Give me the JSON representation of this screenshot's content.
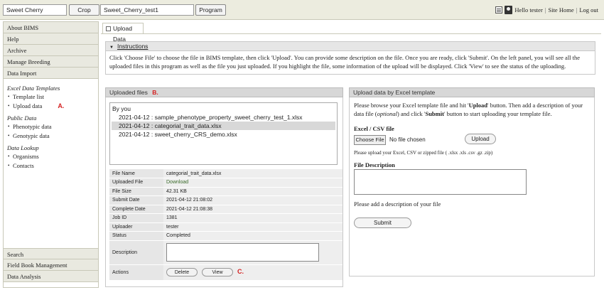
{
  "topbar": {
    "organism_value": "Sweet Cherry",
    "crop_button": "Crop",
    "program_value": "Sweet_Cherry_test1",
    "program_button": "Program",
    "greeting": "Hello tester",
    "sep": "|",
    "site_home": "Site Home",
    "logout": "Log out"
  },
  "sidebar": {
    "about": "About BIMS",
    "help": "Help",
    "archive": "Archive",
    "manage_breeding": "Manage Breeding",
    "data_import": "Data Import",
    "excel_section": "Excel Data Templates",
    "template_list": "Template list",
    "upload_data": "Upload data",
    "marker_a": "A.",
    "public_section": "Public Data",
    "phenotypic": "Phenotypic data",
    "genotypic": "Genotypic data",
    "lookup_section": "Data Lookup",
    "organisms": "Organisms",
    "contacts": "Contacts",
    "search": "Search",
    "field_book": "Field Book Management",
    "data_analysis": "Data Analysis"
  },
  "tab": {
    "label": "Upload Data"
  },
  "instructions": {
    "title": "Instructions",
    "line1": "Click 'Choose File' to choose the file in BIMS template, then click 'Upload'. You can provide some description on the file. Once you are ready, click 'Submit'. On the left panel, you will see all the",
    "line2": "uploaded files in this program as well as the file you just uploaded. If you highlight the file, some information of the upload will be displayed. Click 'View' to see the status of the uploading."
  },
  "uploaded": {
    "title": "Uploaded files",
    "marker_b": "B.",
    "by_you": "By you",
    "files": [
      "2021-04-12 : sample_phenotype_property_sweet_cherry_test_1.xlsx",
      "2021-04-12 : categorial_trait_data.xlsx",
      "2021-04-12 : sweet_cherry_CRS_demo.xlsx"
    ],
    "selected_index": 1
  },
  "details": {
    "file_name_k": "File Name",
    "file_name_v": "categorial_trait_data.xlsx",
    "uploaded_file_k": "Uploaded File",
    "uploaded_file_v": "Download",
    "file_size_k": "File Size",
    "file_size_v": "42.31 KB",
    "submit_date_k": "Submit Date",
    "submit_date_v": "2021-04-12 21:08:02",
    "complete_date_k": "Complete Date",
    "complete_date_v": "2021-04-12 21:08:38",
    "job_id_k": "Job ID",
    "job_id_v": "1381",
    "uploader_k": "Uploader",
    "uploader_v": "tester",
    "status_k": "Status",
    "status_v": "Completed",
    "description_k": "Description",
    "actions_k": "Actions",
    "delete_button": "Delete",
    "view_button": "View",
    "marker_c": "C."
  },
  "upload_excel": {
    "title": "Upload data by Excel template",
    "intro_1": "Please browse your Excel template file and hit '",
    "intro_upload": "Upload",
    "intro_2": "' button. Then add a description of your data",
    "intro_3": "file (",
    "intro_optional": "optional",
    "intro_4": ") and click '",
    "intro_submit": "Submit",
    "intro_5": "' button to start uploading your template file.",
    "csv_label": "Excel / CSV file",
    "choose_file": "Choose File",
    "no_file": "No file chosen",
    "upload_button": "Upload",
    "file_hint": "Please upload your Excel, CSV or zipped file ( .xlsx .xls .csv .gz .zip)",
    "desc_label": "File Description",
    "desc_hint": "Please add a description of your file",
    "submit_button": "Submit"
  },
  "colors": {
    "marker_red": "#d42020",
    "topbar_bg": "#ececdf",
    "panel_head_bg": "#d7d7d7"
  }
}
